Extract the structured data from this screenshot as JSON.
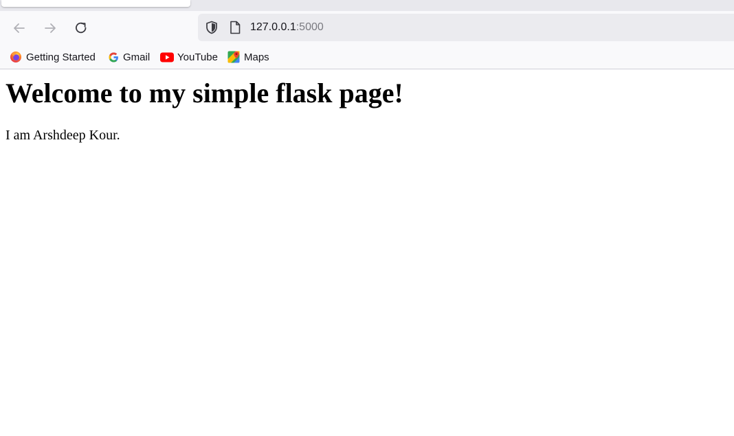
{
  "browser": {
    "nav": {
      "back_icon": "arrow-left-icon",
      "forward_icon": "arrow-right-icon",
      "reload_icon": "reload-icon"
    },
    "address_bar": {
      "host": "127.0.0.1",
      "port": ":5000",
      "security_icon": "shield-icon",
      "page_icon": "page-icon"
    },
    "bookmarks": [
      {
        "label": "Getting Started",
        "icon": "firefox-icon"
      },
      {
        "label": "Gmail",
        "icon": "google-icon"
      },
      {
        "label": "YouTube",
        "icon": "youtube-icon"
      },
      {
        "label": "Maps",
        "icon": "maps-icon"
      }
    ]
  },
  "page": {
    "heading": "Welcome to my simple flask page!",
    "paragraph": "I am Arshdeep Kour."
  }
}
